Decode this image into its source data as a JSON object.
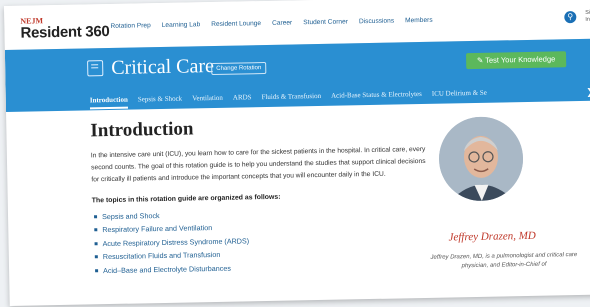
{
  "brand": {
    "nejm": "NEJM",
    "name": "Resident 360"
  },
  "nav": [
    "Rotation Prep",
    "Learning Lab",
    "Resident Lounge",
    "Career",
    "Student Corner",
    "Discussions",
    "Members"
  ],
  "user_fragment": [
    "Si",
    "In"
  ],
  "hero": {
    "title": "Critical Care",
    "change_button": "Change Rotation",
    "test_button": "✎ Test Your Knowledge"
  },
  "tabs": [
    {
      "label": "Introduction",
      "active": true
    },
    {
      "label": "Sepsis & Shock"
    },
    {
      "label": "Ventilation"
    },
    {
      "label": "ARDS"
    },
    {
      "label": "Fluids & Transfusion"
    },
    {
      "label": "Acid-Base Status & Electrolytes"
    },
    {
      "label": "ICU Delirium & Se"
    }
  ],
  "content": {
    "title": "Introduction",
    "intro": "In the intensive care unit (ICU), you learn how to care for the sickest patients in the hospital. In critical care, every second counts. The goal of this rotation guide is to help you understand the studies that support clinical decisions for critically ill patients and introduce the important concepts that you will encounter daily in the ICU.",
    "topics_heading": "The topics in this rotation guide are organized as follows:",
    "topics": [
      "Sepsis and Shock",
      "Respiratory Failure and Ventilation",
      "Acute Respiratory Distress Syndrome (ARDS)",
      "Resuscitation Fluids and Transfusion",
      "Acid–Base and Electrolyte Disturbances"
    ]
  },
  "author": {
    "signature": "Jeffrey Drazen, MD",
    "bio": "Jeffrey Drazen, MD, is a pulmonologist and critical care physician, and Editor-in-Chief of"
  },
  "colors": {
    "hero": "#2a8fd2",
    "test_button": "#5cb85c",
    "link": "#1f5f92",
    "signature": "#c0392b"
  }
}
